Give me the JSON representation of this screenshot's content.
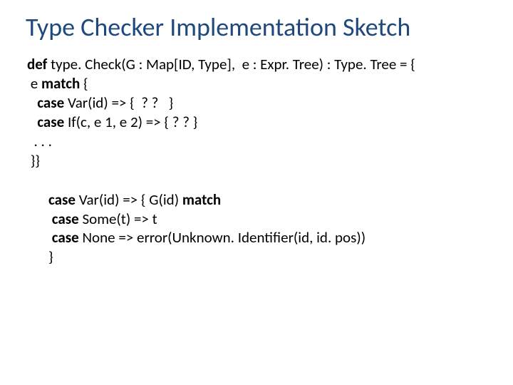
{
  "title": "Type Checker Implementation Sketch",
  "code1": {
    "l1a": "def",
    "l1b": " type. Check(",
    "l1c": "G",
    "l1d": " : Map[ID, Type],  e : Expr. Tree) : Type. Tree = {",
    "l2a": " e ",
    "l2b": "match",
    "l2c": " {",
    "l3a": "   ",
    "l3b": "case",
    "l3c": " Var(id) => {  ? ?   }",
    "l4a": "   ",
    "l4b": "case",
    "l4c": " If(c, e 1, e 2) => { ? ? }",
    "l5": "  . . .",
    "l6": " }}"
  },
  "code2": {
    "l1a": "case",
    "l1b": " Var(id) => { ",
    "l1c": "G",
    "l1d": "(id) ",
    "l1e": "match",
    "l2a": " ",
    "l2b": "case",
    "l2c": " Some(t) => t",
    "l3a": " ",
    "l3b": "case",
    "l3c": " None => error(Unknown. Identifier(id, id. pos))",
    "l4": "}"
  }
}
